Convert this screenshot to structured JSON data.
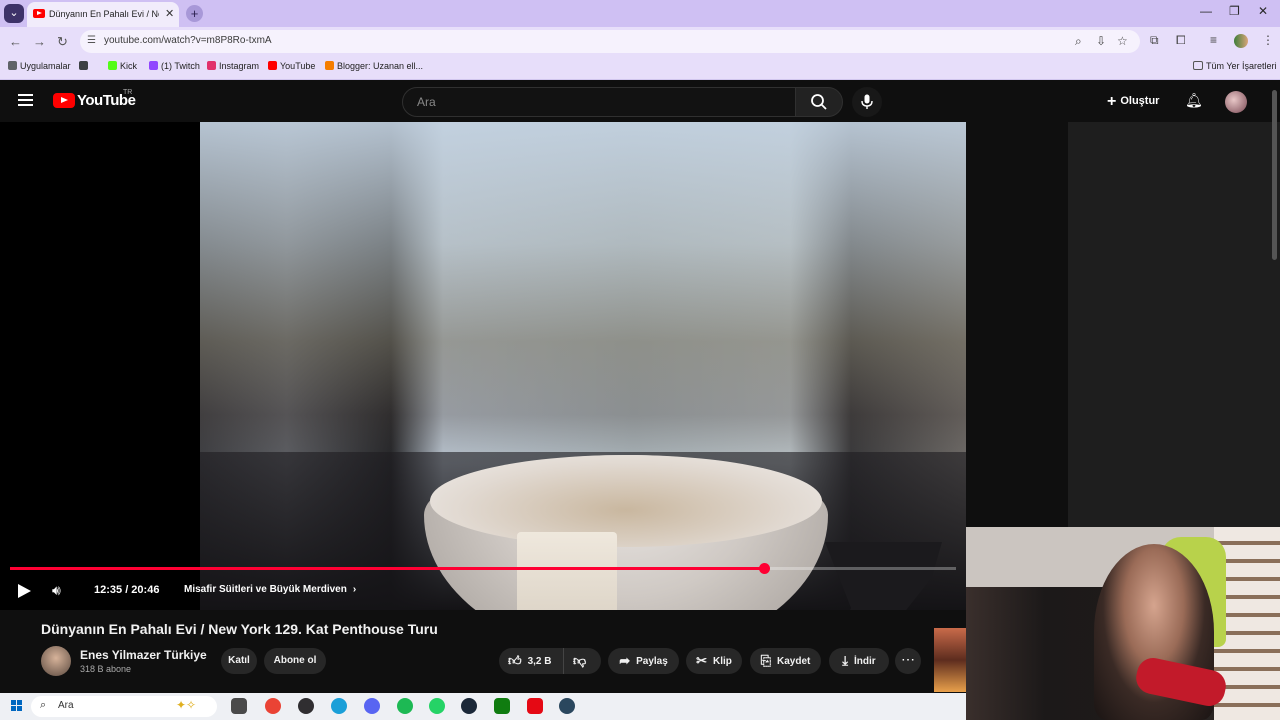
{
  "browser": {
    "tab_title": "Dünyanın En Pahalı Evi / New Y",
    "url": "youtube.com/watch?v=m8P8Ro-txmA",
    "bookmarks": [
      {
        "label": "Uygulamalar",
        "color": "#5f6368"
      },
      {
        "label": "",
        "color": "#3c4043"
      },
      {
        "label": "Kick",
        "color": "#53fc18"
      },
      {
        "label": "(1) Twitch",
        "color": "#9146ff"
      },
      {
        "label": "Instagram",
        "color": "#e1306c"
      },
      {
        "label": "YouTube",
        "color": "#ff0000"
      },
      {
        "label": "Blogger: Uzanan ell...",
        "color": "#f57d00"
      }
    ],
    "all_bookmarks": "Tüm Yer İşaretleri"
  },
  "youtube": {
    "logo_text": "YouTube",
    "region": "TR",
    "search_placeholder": "Ara",
    "create_label": "Oluştur"
  },
  "player": {
    "progress_fraction": 0.7966,
    "time": "12:35 / 20:46",
    "chapter": "Misafir Süitleri ve Büyük Merdiven"
  },
  "video": {
    "title": "Dünyanın En Pahalı Evi / New York 129. Kat Penthouse Turu",
    "channel": "Enes Yilmazer Türkiye",
    "subscribers": "318 B abone",
    "join_label": "Katıl",
    "subscribe_label": "Abone ol",
    "likes": "3,2 B",
    "share_label": "Paylaş",
    "clip_label": "Klip",
    "save_label": "Kaydet",
    "download_label": "İndir"
  },
  "taskbar": {
    "search_text": "Ara",
    "apps": [
      {
        "name": "task-view",
        "color": "#4a4a4a"
      },
      {
        "name": "chrome",
        "color": "#ea4335"
      },
      {
        "name": "obs",
        "color": "#302e31"
      },
      {
        "name": "edge",
        "color": "#1a9fd8"
      },
      {
        "name": "discord",
        "color": "#5865f2"
      },
      {
        "name": "spotify",
        "color": "#1db954"
      },
      {
        "name": "whatsapp",
        "color": "#25d366"
      },
      {
        "name": "steam",
        "color": "#1b2838"
      },
      {
        "name": "xbox",
        "color": "#107c10"
      },
      {
        "name": "netflix",
        "color": "#e50914"
      },
      {
        "name": "steam-2",
        "color": "#2a475e"
      }
    ]
  }
}
